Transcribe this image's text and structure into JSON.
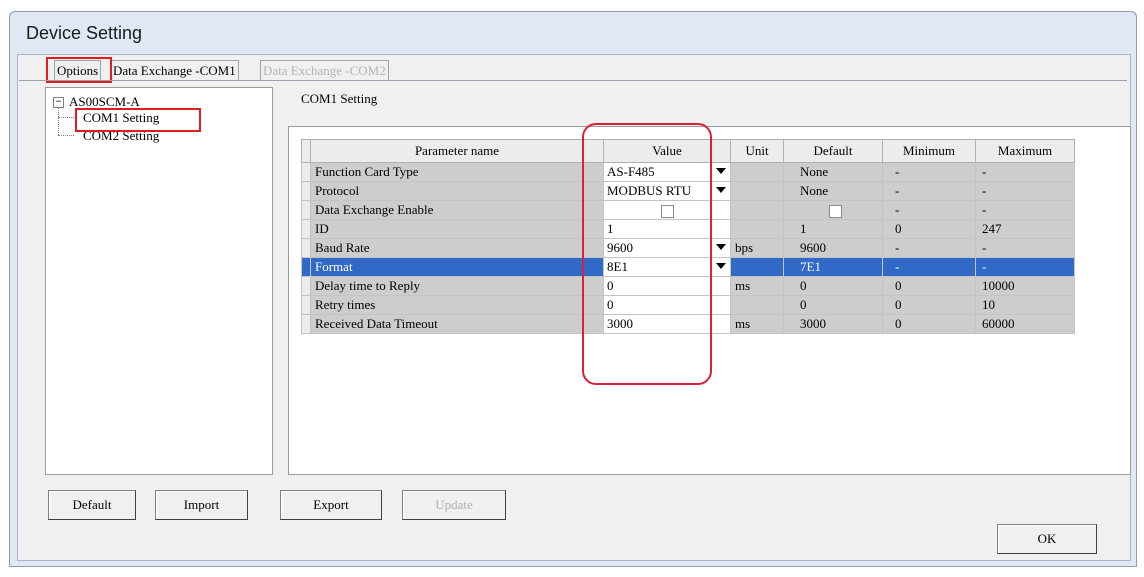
{
  "window": {
    "title": "Device Setting"
  },
  "tabs": [
    {
      "label": "Options",
      "state": "active"
    },
    {
      "label": "Data Exchange -COM1",
      "state": "normal"
    },
    {
      "label": "Data Exchange -COM2",
      "state": "disabled"
    }
  ],
  "tree": {
    "root": "AS00SCM-A",
    "root_toggle": "−",
    "children": [
      "COM1 Setting",
      "COM2 Setting"
    ],
    "selected": "COM1 Setting"
  },
  "section_label": "COM1 Setting",
  "table": {
    "headers": [
      "Parameter name",
      "Value",
      "Unit",
      "Default",
      "Minimum",
      "Maximum"
    ],
    "rows": [
      {
        "name": "Function Card Type",
        "value": "AS-F485",
        "control": "dropdown",
        "unit": "",
        "default": "None",
        "min": "-",
        "max": "-"
      },
      {
        "name": "Protocol",
        "value": "MODBUS RTU",
        "control": "dropdown",
        "unit": "",
        "default": "None",
        "min": "-",
        "max": "-"
      },
      {
        "name": "Data Exchange Enable",
        "value": "",
        "control": "checkbox",
        "unit": "",
        "default": "",
        "min": "-",
        "max": "-"
      },
      {
        "name": "ID",
        "value": "1",
        "control": "text",
        "unit": "",
        "default": "1",
        "min": "0",
        "max": "247"
      },
      {
        "name": "Baud Rate",
        "value": "9600",
        "control": "dropdown",
        "unit": "bps",
        "default": "9600",
        "min": "-",
        "max": "-"
      },
      {
        "name": "Format",
        "value": "8E1",
        "control": "dropdown",
        "unit": "",
        "default": "7E1",
        "min": "-",
        "max": "-",
        "selected": true
      },
      {
        "name": "Delay time to Reply",
        "value": "0",
        "control": "text",
        "unit": "ms",
        "default": "0",
        "min": "0",
        "max": "10000"
      },
      {
        "name": "Retry times",
        "value": "0",
        "control": "text",
        "unit": "",
        "default": "0",
        "min": "0",
        "max": "10"
      },
      {
        "name": "Received Data Timeout",
        "value": "3000",
        "control": "text",
        "unit": "ms",
        "default": "3000",
        "min": "0",
        "max": "60000"
      }
    ]
  },
  "buttons": {
    "default": "Default",
    "import": "Import",
    "export": "Export",
    "update": "Update",
    "ok": "OK"
  },
  "colors": {
    "highlight_annotation": "#e01c1c",
    "selection": "#3169c6"
  }
}
